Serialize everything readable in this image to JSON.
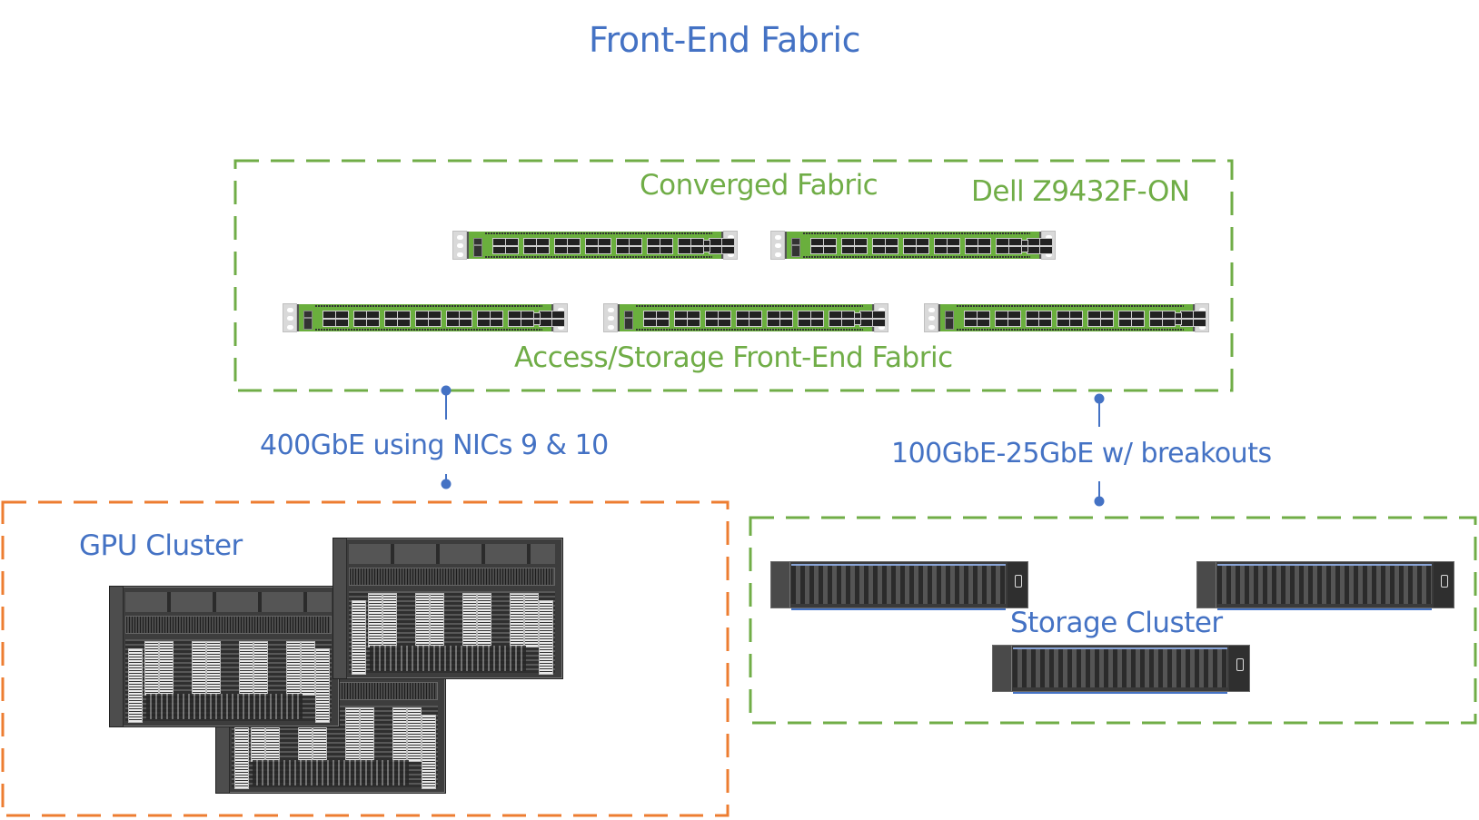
{
  "title": "Front-End Fabric",
  "colors": {
    "title_blue": "#4472c4",
    "fabric_green": "#70ad47",
    "gpu_orange": "#ed7d31",
    "switch_green": "#6aaf3d",
    "server_dark": "#3a3a3a"
  },
  "fabric_group": {
    "converged_label": "Converged Fabric",
    "model_label": "Dell Z9432F-ON",
    "access_label": "Access/Storage Front-End Fabric",
    "converged_switches": [
      {
        "name": "Dell Z9432F-ON"
      },
      {
        "name": "Dell Z9432F-ON"
      }
    ],
    "access_switches": [
      {
        "name": "Dell Z9432F-ON"
      },
      {
        "name": "Dell Z9432F-ON"
      },
      {
        "name": "Dell Z9432F-ON"
      }
    ]
  },
  "links": [
    {
      "label": "400GbE using NICs 9 & 10",
      "from": "fabric",
      "to": "gpu_cluster"
    },
    {
      "label": "100GbE-25GbE w/ breakouts",
      "from": "fabric",
      "to": "storage_cluster"
    }
  ],
  "gpu_cluster": {
    "label": "GPU Cluster",
    "servers": 3
  },
  "storage_cluster": {
    "label": "Storage Cluster",
    "servers": 3
  }
}
